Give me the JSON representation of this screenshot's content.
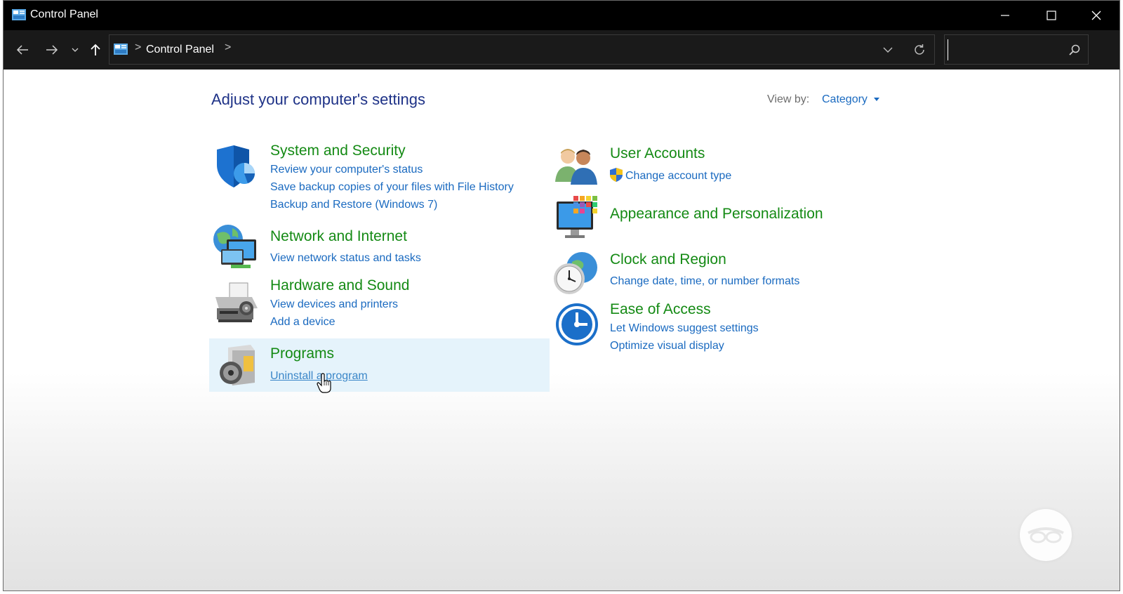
{
  "window": {
    "title": "Control Panel"
  },
  "nav": {
    "breadcrumb": "Control Panel",
    "separator": ">",
    "search": {
      "value": "",
      "placeholder": ""
    }
  },
  "main": {
    "heading": "Adjust your computer's settings",
    "view_by": {
      "label": "View by:",
      "value": "Category"
    },
    "left": [
      {
        "title": "System and Security",
        "icon": "shield-icon",
        "links": [
          "Review your computer's status",
          "Save backup copies of your files with File History",
          "Backup and Restore (Windows 7)"
        ]
      },
      {
        "title": "Network and Internet",
        "icon": "globe-network-icon",
        "links": [
          "View network status and tasks"
        ]
      },
      {
        "title": "Hardware and Sound",
        "icon": "printer-icon",
        "links": [
          "View devices and printers",
          "Add a device"
        ]
      },
      {
        "title": "Programs",
        "icon": "programs-disc-icon",
        "links": [
          "Uninstall a program"
        ]
      }
    ],
    "right": [
      {
        "title": "User Accounts",
        "icon": "users-icon",
        "links": [
          "Change account type"
        ]
      },
      {
        "title": "Appearance and Personalization",
        "icon": "monitor-palette-icon",
        "links": []
      },
      {
        "title": "Clock and Region",
        "icon": "clock-globe-icon",
        "links": [
          "Change date, time, or number formats"
        ]
      },
      {
        "title": "Ease of Access",
        "icon": "ease-of-access-icon",
        "links": [
          "Let Windows suggest settings",
          "Optimize visual display"
        ]
      }
    ]
  },
  "colors": {
    "title_green": "#148a14",
    "link_blue": "#1a6ac0",
    "heading_blue": "#1e3287",
    "highlight": "#e5f3fb"
  }
}
